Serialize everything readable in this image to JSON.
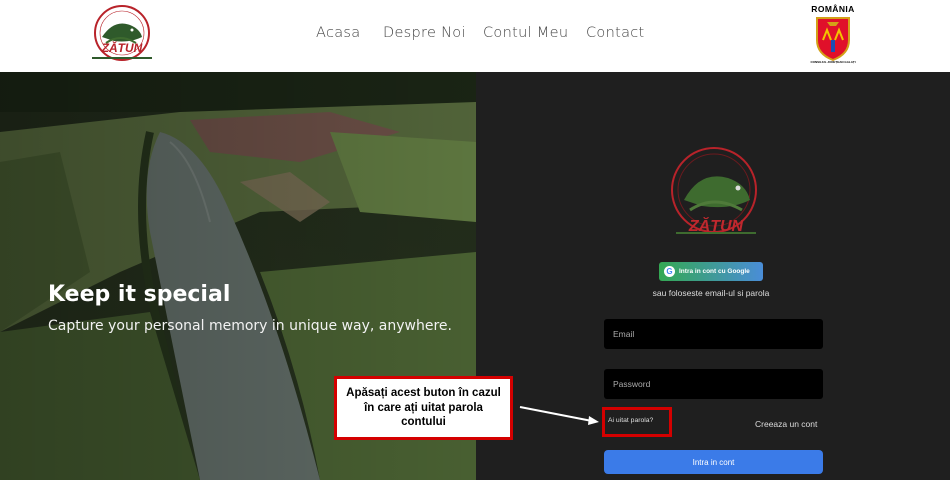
{
  "header": {
    "logo_text": "ZĂTUN",
    "logo_ring_text": "BAZA DE AGREMENT CU SPECIFIC PESCARESC",
    "nav": [
      "Acasa",
      "Despre Noi",
      "Contul Meu",
      "Contact"
    ],
    "crest_label": "ROMÂNIA",
    "crest_caption": "CONSILIUL JUDEȚEAN GALAȚI"
  },
  "hero": {
    "title": "Keep it special",
    "subtitle": "Capture your personal memory in unique way, anywhere."
  },
  "login": {
    "logo_text": "ZĂTUN",
    "google_label": "Intra in cont cu Google",
    "alt_text": "sau foloseste email-ul si parola",
    "email_placeholder": "Email",
    "password_placeholder": "Password",
    "forgot_label": "Ai uitat parola?",
    "create_label": "Creeaza un cont",
    "submit_label": "Intra in cont"
  },
  "annotation": {
    "text": "Apăsați acest buton în cazul în care ați uitat parola contului"
  },
  "colors": {
    "accent_red": "#d40000",
    "panel_bg": "#1f1f1f",
    "primary_button": "#3b7be8",
    "logo_red": "#b8232a",
    "logo_green": "#2f5a2b"
  }
}
